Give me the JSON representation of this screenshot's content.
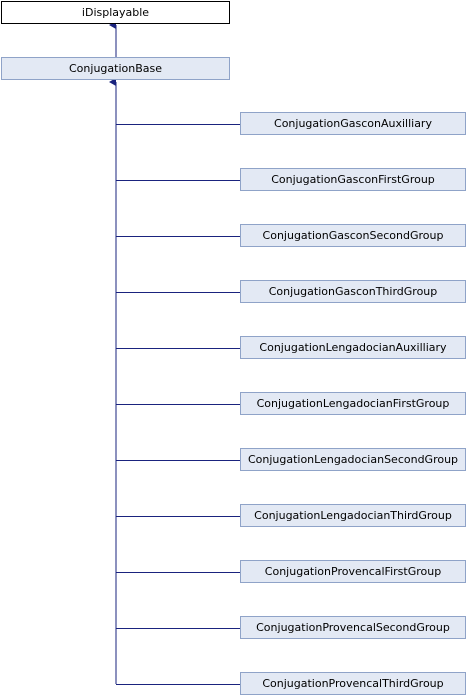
{
  "diagram": {
    "root": {
      "label": "iDisplayable"
    },
    "base": {
      "label": "ConjugationBase"
    },
    "children": [
      {
        "label": "ConjugationGasconAuxilliary"
      },
      {
        "label": "ConjugationGasconFirstGroup"
      },
      {
        "label": "ConjugationGasconSecondGroup"
      },
      {
        "label": "ConjugationGasconThirdGroup"
      },
      {
        "label": "ConjugationLengadocianAuxilliary"
      },
      {
        "label": "ConjugationLengadocianFirstGroup"
      },
      {
        "label": "ConjugationLengadocianSecondGroup"
      },
      {
        "label": "ConjugationLengadocianThirdGroup"
      },
      {
        "label": "ConjugationProvencalFirstGroup"
      },
      {
        "label": "ConjugationProvencalSecondGroup"
      },
      {
        "label": "ConjugationProvencalThirdGroup"
      }
    ]
  },
  "colors": {
    "node_fill": "#e3e9f4",
    "node_border": "#8fa3c8",
    "root_fill": "#ffffff",
    "root_border": "#000000",
    "edge": "#1a237e"
  }
}
